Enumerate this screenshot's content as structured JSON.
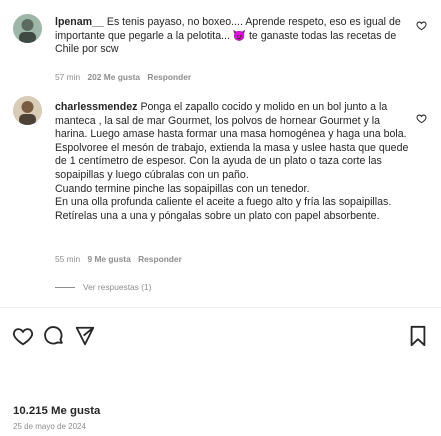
{
  "comments": [
    {
      "username": "lpenam__",
      "text": "Es tenis payaso, no boxeo.... Aprende respeto, eso es igual de importante que pegarle a la pelotita... 😈 te ganaste todas las recetas de Chile por scw",
      "time": "57 min",
      "likes": "202 Me gusta",
      "reply_label": "Responder"
    },
    {
      "username": "charlessmendez",
      "paragraphs": [
        "Ponga el zapallo cocido y molido en un bol junto a la manteca , la sal de mar Gourmet, los polvos de hornear Gourmet y la harina. Luego amase hasta formar una masa homogénea y haga una bola.",
        "Espolvoree el mesón de trabajo, extienda la masa y uslee hasta que quede de 1 centímetro de espesor. Con la ayuda de un plato o taza corte las sopaipillas y luego cúbralas con un paño.",
        "Cuando termine pinche las sopaipillas con un tenedor.",
        "En una olla profunda caliente el aceite a fuego alto y fría las sopaipillas. Retírelas una a una y póngalas sobre un plato con papel absorbente."
      ],
      "time": "55 min",
      "likes": "9 Me gusta",
      "reply_label": "Responder"
    }
  ],
  "view_replies": "Ver respuestas (1)",
  "actions": {
    "like_icon": "heart-icon",
    "comment_icon": "comment-icon",
    "share_icon": "send-icon",
    "save_icon": "bookmark-icon"
  },
  "post": {
    "likes": "10.215 Me gusta",
    "date": "25 de mayo de 2024"
  },
  "colors": {
    "text": "#262626",
    "muted": "#8e8e8e",
    "background": "#ffffff"
  }
}
